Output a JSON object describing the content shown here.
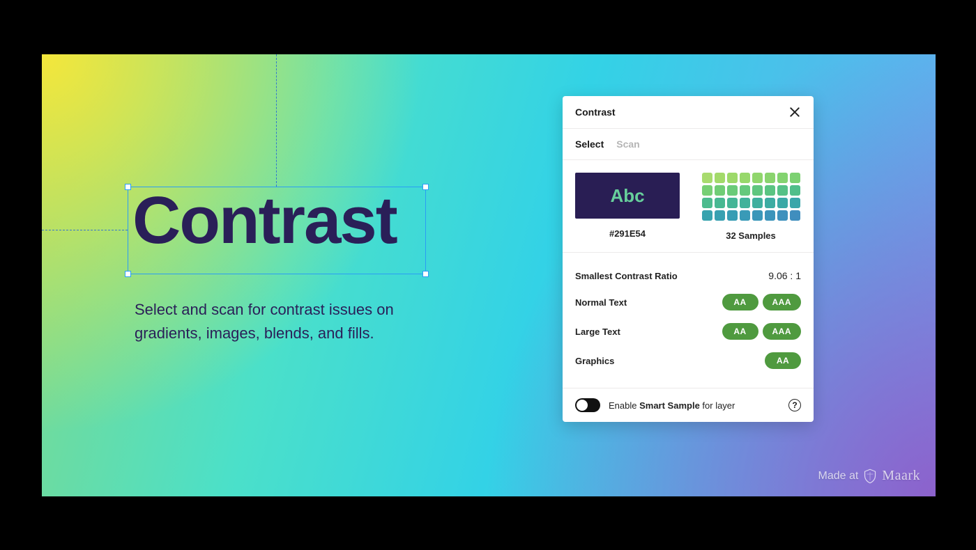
{
  "hero": {
    "title": "Contrast",
    "subtitle": "Select and scan for contrast issues on gradients, images, blends, and fills."
  },
  "panel": {
    "title": "Contrast",
    "tabs": {
      "select": "Select",
      "scan": "Scan"
    },
    "foreground": {
      "sample_text": "Abc",
      "hex": "#291E54"
    },
    "samples": {
      "count_label": "32 Samples",
      "colors": [
        "#a8db6e",
        "#a3da6a",
        "#9dd96a",
        "#97d86b",
        "#90d66c",
        "#8ad46e",
        "#83d370",
        "#7cd172",
        "#76cf74",
        "#70cd76",
        "#6acb79",
        "#65c97c",
        "#5fc67f",
        "#5ac482",
        "#55c186",
        "#50be8a",
        "#4cbb8e",
        "#48b892",
        "#44b596",
        "#41b29a",
        "#3eaf9e",
        "#3caca2",
        "#3aa9a6",
        "#39a6aa",
        "#38a3ae",
        "#38a0b1",
        "#389db4",
        "#399ab7",
        "#3a97b9",
        "#3c94bb",
        "#3e91bd",
        "#408ebe"
      ]
    },
    "metrics": {
      "ratio_label": "Smallest Contrast Ratio",
      "ratio_value": "9.06 : 1",
      "rows": [
        {
          "label": "Normal Text",
          "pills": [
            "AA",
            "AAA"
          ]
        },
        {
          "label": "Large Text",
          "pills": [
            "AA",
            "AAA"
          ]
        },
        {
          "label": "Graphics",
          "pills": [
            "AA"
          ]
        }
      ]
    },
    "footer": {
      "toggle_prefix": "Enable ",
      "toggle_strong": "Smart Sample",
      "toggle_suffix": " for layer"
    }
  },
  "credit": {
    "prefix": "Made at",
    "brand": "Maark"
  }
}
